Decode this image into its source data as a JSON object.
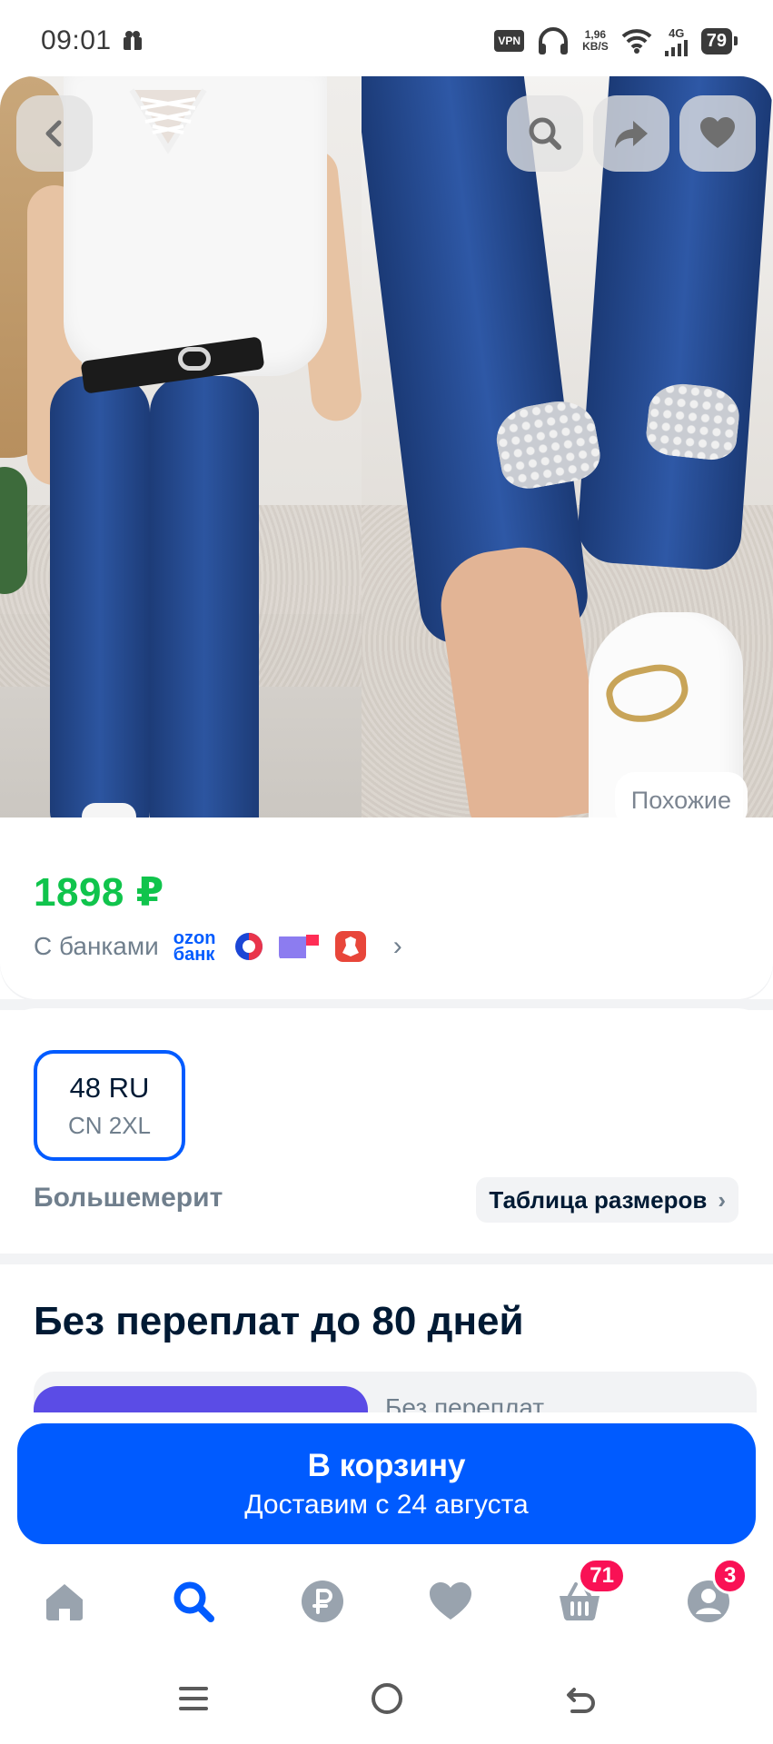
{
  "status_bar": {
    "time": "09:01",
    "vpn": "VPN",
    "speed_value": "1,96",
    "speed_unit": "KB/S",
    "network": "4G",
    "battery": "79"
  },
  "gallery": {
    "back_icon": "chevron-left-icon",
    "search_icon": "search-icon",
    "share_icon": "share-icon",
    "favorite_icon": "heart-icon",
    "similar_label": "Похожие"
  },
  "price": {
    "value": "1898 ₽",
    "banks_label": "С банками",
    "ozon_bank_line1": "ozon",
    "ozon_bank_line2": "банк",
    "colors": {
      "price": "#10c44c",
      "accent": "#005bff"
    }
  },
  "size": {
    "selected_main": "48 RU",
    "selected_sub": "CN 2XL",
    "fit_note": "Большемерит",
    "table_label": "Таблица размеров"
  },
  "installment": {
    "title": "Без переплат до 80 дней",
    "text": "Без переплат"
  },
  "cart": {
    "label": "В корзину",
    "delivery": "Доставим с 24 августа"
  },
  "bottom_nav": {
    "items": [
      {
        "name": "home",
        "icon": "home-icon",
        "active": false
      },
      {
        "name": "search",
        "icon": "search-icon",
        "active": true
      },
      {
        "name": "finance",
        "icon": "ruble-icon",
        "active": false
      },
      {
        "name": "favorites",
        "icon": "heart-icon",
        "active": false
      },
      {
        "name": "cart",
        "icon": "basket-icon",
        "active": false,
        "badge": "71"
      },
      {
        "name": "profile",
        "icon": "profile-icon",
        "active": false,
        "badge": "3"
      }
    ]
  },
  "system_nav": {
    "menu_icon": "menu-icon",
    "home_icon": "circle-home-icon",
    "back_icon": "back-arrow-icon"
  }
}
